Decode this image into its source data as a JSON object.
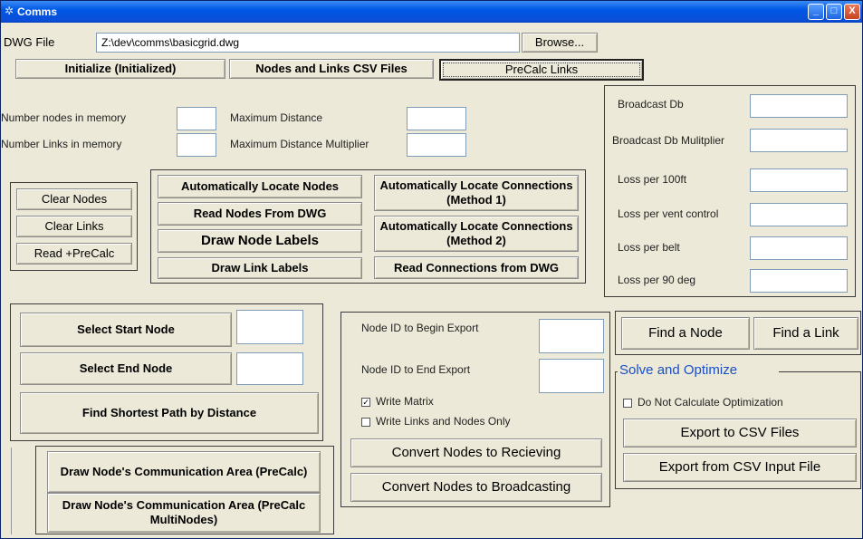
{
  "window": {
    "title": "Comms",
    "icon": "gear-icon",
    "controls": {
      "minimize": "_",
      "maximize": "□",
      "close": "X"
    }
  },
  "dwg": {
    "label": "DWG File",
    "path": "Z:\\dev\\comms\\basicgrid.dwg",
    "browse": "Browse..."
  },
  "top_buttons": {
    "initialize": "Initialize (Initialized)",
    "nodes_links_csv": "Nodes and Links CSV Files",
    "precalc_links": "PreCalc Links"
  },
  "stats": {
    "num_nodes": "Number nodes in memory",
    "num_links": "Number Links in memory",
    "max_distance": "Maximum Distance",
    "max_distance_mult": "Maximum Distance Multiplier"
  },
  "broadcast": {
    "db": "Broadcast Db",
    "db_mult": "Broadcast Db Mulitplier",
    "loss_100ft": "Loss per 100ft",
    "loss_vent": "Loss per vent control",
    "loss_belt": "Loss per belt",
    "loss_90": "Loss per 90 deg"
  },
  "clear": {
    "clear_nodes": "Clear Nodes",
    "clear_links": "Clear Links",
    "read_precalc": "Read +PreCalc"
  },
  "locate": {
    "auto_nodes": "Automatically Locate Nodes",
    "read_nodes": "Read Nodes From DWG",
    "draw_node_labels": "Draw Node Labels",
    "draw_link_labels": "Draw Link Labels",
    "auto_conn1": "Automatically Locate Connections (Method 1)",
    "auto_conn2": "Automatically Locate Connections (Method 2)",
    "read_conn": "Read Connections from DWG"
  },
  "path": {
    "start": "Select Start Node",
    "end": "Select End Node",
    "shortest": "Find Shortest Path by Distance"
  },
  "comm_area": {
    "precalc": "Draw  Node's Communication Area (PreCalc)",
    "multinodes": "Draw  Node's Communication Area (PreCalc MultiNodes)"
  },
  "export": {
    "begin": "Node ID to Begin Export",
    "end": "Node ID to End Export",
    "write_matrix": "Write Matrix",
    "write_matrix_checked": true,
    "write_links_nodes": "Write Links and Nodes Only",
    "write_links_nodes_checked": false,
    "to_receiving": "Convert Nodes to Recieving",
    "to_broadcasting": "Convert Nodes to Broadcasting"
  },
  "find": {
    "node": "Find a Node",
    "link": "Find a Link"
  },
  "solve": {
    "title": "Solve and Optimize",
    "no_opt": "Do Not Calculate Optimization",
    "no_opt_checked": false,
    "export_csv": "Export to CSV Files",
    "export_from_csv": "Export from CSV Input File"
  },
  "colors": {
    "title_bar": "#0058e6",
    "face": "#ece9d8",
    "accent_text": "#1a4fc4"
  }
}
